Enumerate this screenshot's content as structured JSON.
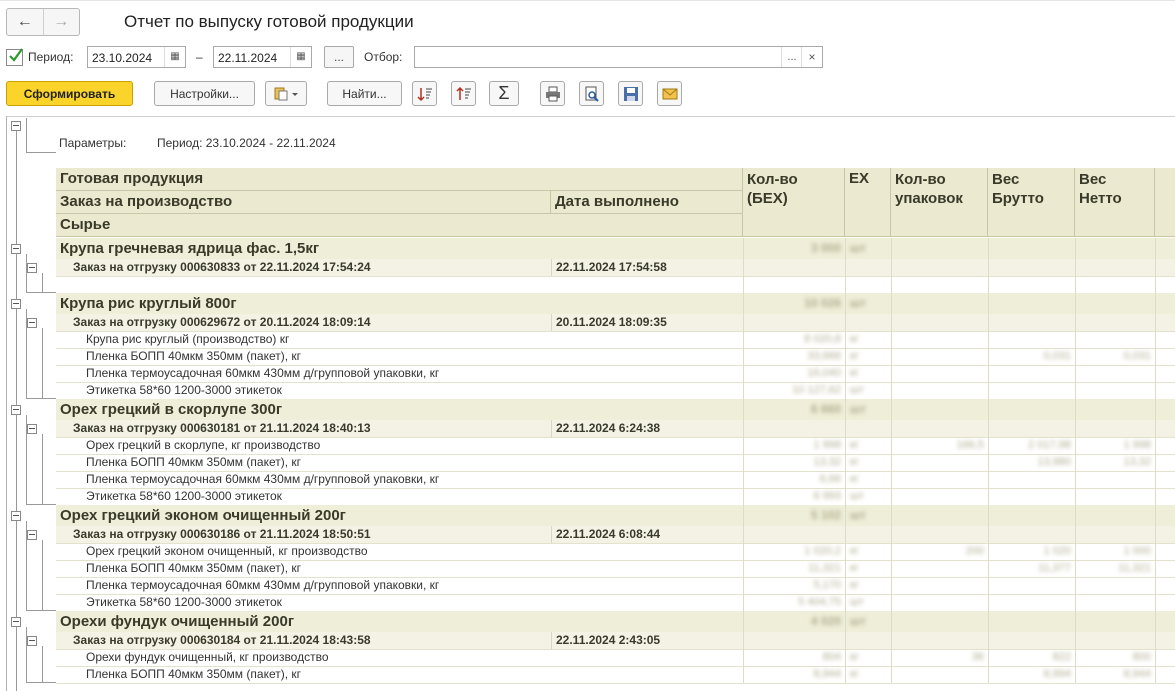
{
  "window": {
    "title": "Отчет по выпуску готовой продукции",
    "back_icon": "←",
    "forward_icon": "→"
  },
  "filter": {
    "period_label": "Период:",
    "date_from": "23.10.2024",
    "date_to": "22.11.2024",
    "dash": "–",
    "ellipsis": "...",
    "selection_label": "Отбор:",
    "selection_value": "",
    "clear": "×"
  },
  "toolbar": {
    "generate": "Сформировать",
    "settings": "Настройки...",
    "find": "Найти..."
  },
  "report": {
    "params_label": "Параметры:",
    "params_value": "Период: 23.10.2024 - 22.11.2024",
    "headers": {
      "product": "Готовая продукция",
      "order": "Заказ на производство",
      "date_done": "Дата выполнено",
      "raw": "Сырье",
      "qty": "Кол-во (БЕХ)",
      "ex": "ЕХ",
      "packs": "Кол-во упаковок",
      "gross": "Вес Брутто",
      "net": "Вес Нетто"
    },
    "groups": [
      {
        "name": "Крупа гречневая ядрица фас. 1,5кг",
        "qty": "3 000",
        "unit": "шт",
        "order": "Заказ на отгрузку 000630833 от 22.11.2024 17:54:24",
        "date": "22.11.2024 17:54:58",
        "materials": []
      },
      {
        "name": "Крупа рис круглый 800г",
        "qty": "10 026",
        "unit": "шт",
        "order": "Заказ на отгрузку 000629672 от 20.11.2024 18:09:14",
        "date": "20.11.2024 18:09:35",
        "materials": [
          {
            "name": "Крупа рис круглый (производство) кг",
            "qty": "8 020,8",
            "unit": "кг",
            "packs": "",
            "gross": "",
            "net": ""
          },
          {
            "name": "Пленка БОПП 40мкм 350мм (пакет), кг",
            "qty": "33,666",
            "unit": "кг",
            "packs": "",
            "gross": "0,031",
            "net": "0,031"
          },
          {
            "name": "Пленка термоусадочная 60мкм 430мм д/групповой упаковки, кг",
            "qty": "16,040",
            "unit": "кг",
            "packs": "",
            "gross": "",
            "net": ""
          },
          {
            "name": "Этикетка 58*60 1200-3000 этикеток",
            "qty": "10 127,62",
            "unit": "шт",
            "packs": "",
            "gross": "",
            "net": ""
          }
        ]
      },
      {
        "name": "Орех грецкий в скорлупе 300г",
        "qty": "6 660",
        "unit": "шт",
        "order": "Заказ на отгрузку 000630181 от 21.11.2024 18:40:13",
        "date": "22.11.2024 6:24:38",
        "materials": [
          {
            "name": "Орех грецкий в скорлупе, кг производство",
            "qty": "1 998",
            "unit": "кг",
            "packs": "166,5",
            "gross": "2 017,98",
            "net": "1 998"
          },
          {
            "name": "Пленка БОПП 40мкм 350мм (пакет), кг",
            "qty": "13,32",
            "unit": "кг",
            "packs": "",
            "gross": "13,980",
            "net": "13,32"
          },
          {
            "name": "Пленка термоусадочная 60мкм 430мм д/групповой упаковки, кг",
            "qty": "6,66",
            "unit": "кг",
            "packs": "",
            "gross": "",
            "net": ""
          },
          {
            "name": "Этикетка 58*60 1200-3000 этикеток",
            "qty": "6 993",
            "unit": "шт",
            "packs": "",
            "gross": "",
            "net": ""
          }
        ]
      },
      {
        "name": "Орех грецкий эконом очищенный 200г",
        "qty": "5 102",
        "unit": "шт",
        "order": "Заказ на отгрузку 000630186 от 21.11.2024 18:50:51",
        "date": "22.11.2024 6:08:44",
        "materials": [
          {
            "name": "Орех грецкий эконом очищенный, кг производство",
            "qty": "1 020,2",
            "unit": "кг",
            "packs": "200",
            "gross": "1 020",
            "net": "1 000"
          },
          {
            "name": "Пленка БОПП 40мкм 350мм (пакет), кг",
            "qty": "11,321",
            "unit": "кг",
            "packs": "",
            "gross": "11,377",
            "net": "11,321"
          },
          {
            "name": "Пленка термоусадочная 60мкм 430мм д/групповой упаковки, кг",
            "qty": "5,170",
            "unit": "кг",
            "packs": "",
            "gross": "",
            "net": ""
          },
          {
            "name": "Этикетка 58*60 1200-3000 этикеток",
            "qty": "5 404,75",
            "unit": "шт",
            "packs": "",
            "gross": "",
            "net": ""
          }
        ]
      },
      {
        "name": "Орехи фундук очищенный 200г",
        "qty": "4 020",
        "unit": "шт",
        "order": "Заказ на отгрузку 000630184 от 21.11.2024 18:43:58",
        "date": "22.11.2024 2:43:05",
        "materials": [
          {
            "name": "Орехи фундук очищенный, кг производство",
            "qty": "804",
            "unit": "кг",
            "packs": "36",
            "gross": "822",
            "net": "800"
          },
          {
            "name": "Пленка БОПП 40мкм 350мм (пакет), кг",
            "qty": "8,944",
            "unit": "кг",
            "packs": "",
            "gross": "8,994",
            "net": "8,944"
          }
        ]
      }
    ]
  }
}
